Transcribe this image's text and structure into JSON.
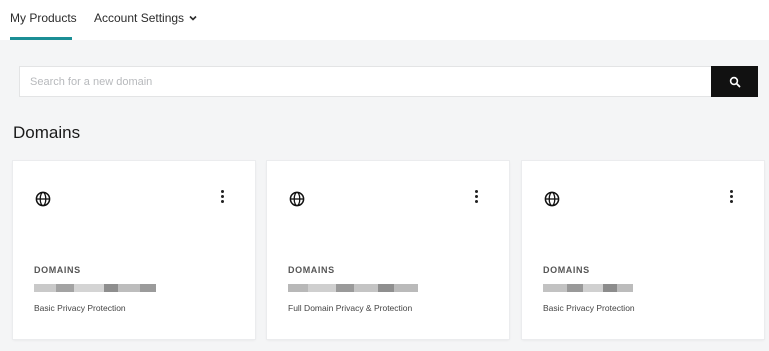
{
  "nav": {
    "tabs": [
      {
        "label": "My Products",
        "active": true
      },
      {
        "label": "Account Settings",
        "has_dropdown": true
      }
    ],
    "accent_color": "#1b8e95"
  },
  "search": {
    "placeholder": "Search for a new domain",
    "value": "",
    "button_icon": "search-icon"
  },
  "section": {
    "title": "Domains"
  },
  "cards": [
    {
      "icon": "globe-icon",
      "label": "DOMAINS",
      "plan": "Basic Privacy Protection"
    },
    {
      "icon": "globe-icon",
      "label": "DOMAINS",
      "plan": "Full Domain Privacy & Protection"
    },
    {
      "icon": "globe-icon",
      "label": "DOMAINS",
      "plan": "Basic Privacy Protection"
    }
  ]
}
